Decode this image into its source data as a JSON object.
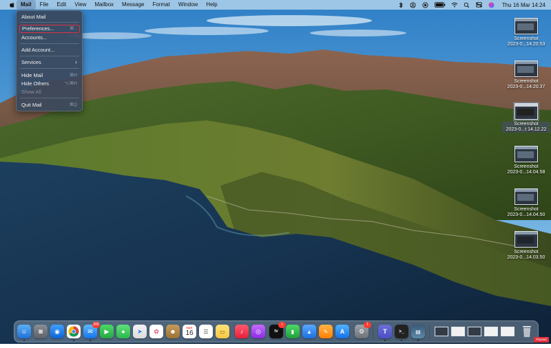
{
  "menubar": {
    "apple_icon": "apple-logo-icon",
    "app_name": "Mail",
    "menus": [
      "File",
      "Edit",
      "View",
      "Mailbox",
      "Message",
      "Format",
      "Window",
      "Help"
    ],
    "status_icons": [
      "bluetooth-icon",
      "focus-icon",
      "screen-record-icon",
      "battery-icon",
      "wifi-icon",
      "search-icon",
      "control-center-icon",
      "siri-icon"
    ],
    "clock": "Thu 16 Mar  14:24"
  },
  "mail_menu": {
    "about": "About Mail",
    "preferences": "Preferences...",
    "preferences_shortcut": "⌘ ,",
    "accounts": "Accounts...",
    "add_account": "Add Account...",
    "services": "Services",
    "services_arrow": "›",
    "hide_mail": "Hide Mail",
    "hide_mail_shortcut": "⌘H",
    "hide_others": "Hide Others",
    "hide_others_shortcut": "⌥⌘H",
    "show_all": "Show All",
    "quit": "Quit Mail",
    "quit_shortcut": "⌘Q"
  },
  "desktop_icons": [
    {
      "name": "Screenshot",
      "sub": "2023-0...14.20.53"
    },
    {
      "name": "Screenshot",
      "sub": "2023-0...14.20.37"
    },
    {
      "name": "Screenshot",
      "sub": "2023-0...t 14.12.22"
    },
    {
      "name": "Screenshot",
      "sub": "2023-0...14.04.58"
    },
    {
      "name": "Screenshot",
      "sub": "2023-0...14.04.50"
    },
    {
      "name": "Screenshot",
      "sub": "2023-0...14.03.50"
    }
  ],
  "dock": {
    "mail_badge": "209",
    "tv_badge": "1",
    "settings_badge": "1",
    "calendar_month": "MAR",
    "calendar_day": "16",
    "tv_label": "tv"
  },
  "recording_badge": "Paused 3:4m",
  "colors": {
    "highlight_box": "#e0313f",
    "menu_bg": "#3a485c",
    "badge": "#ff3b30"
  }
}
